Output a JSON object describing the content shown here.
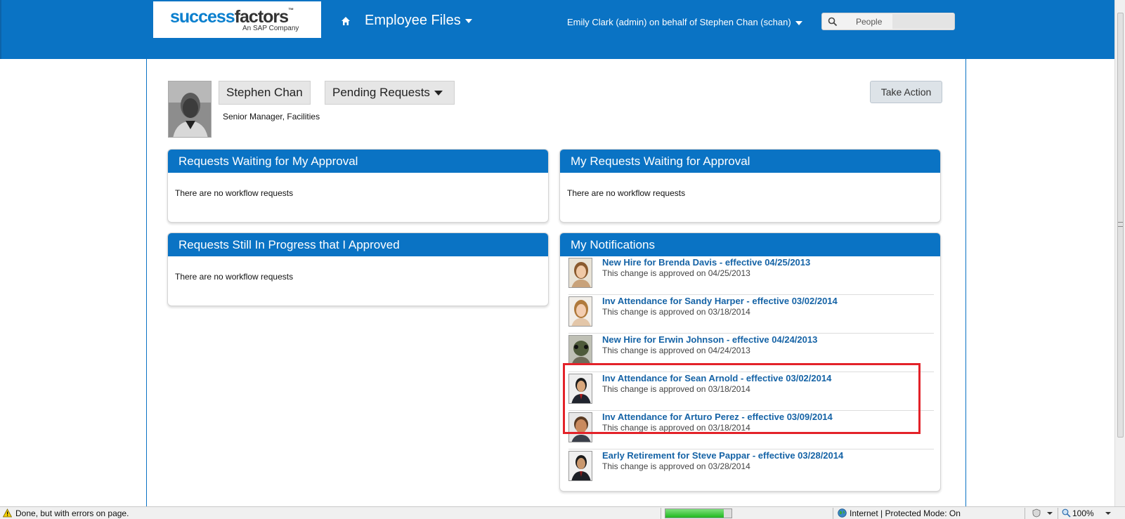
{
  "header": {
    "logo_brand_part1": "success",
    "logo_brand_part2": "factors",
    "logo_tm": "™",
    "logo_sub": "An SAP Company",
    "module_title": "Employee Files",
    "user_menu": "Emily Clark (admin) on behalf of Stephen Chan (schan)",
    "search_placeholder": "People",
    "brand_color": "#0a73c4"
  },
  "profile": {
    "name": "Stephen Chan",
    "view_selector": "Pending Requests",
    "job_title": "Senior Manager, Facilities",
    "take_action": "Take Action"
  },
  "panels": {
    "waiting_my_approval": {
      "title": "Requests Waiting for My Approval",
      "empty": "There are no workflow requests"
    },
    "my_requests_waiting": {
      "title": "My Requests Waiting for Approval",
      "empty": "There are no workflow requests"
    },
    "in_progress_approved": {
      "title": "Requests Still In Progress that I Approved",
      "empty": "There are no workflow requests"
    },
    "notifications": {
      "title": "My Notifications",
      "items": [
        {
          "title": "New Hire for Brenda Davis - effective 04/25/2013",
          "sub": "This change is approved on 04/25/2013"
        },
        {
          "title": "Inv Attendance for Sandy Harper - effective 03/02/2014",
          "sub": "This change is approved on 03/18/2014"
        },
        {
          "title": "New Hire for Erwin Johnson - effective 04/24/2013",
          "sub": "This change is approved on 04/24/2013"
        },
        {
          "title": "Inv Attendance for Sean Arnold - effective 03/02/2014",
          "sub": "This change is approved on 03/18/2014"
        },
        {
          "title": "Inv Attendance for Arturo Perez - effective 03/09/2014",
          "sub": "This change is approved on 03/18/2014"
        },
        {
          "title": "Early Retirement for Steve Pappar - effective 03/28/2014",
          "sub": "This change is approved on 03/28/2014"
        }
      ]
    }
  },
  "statusbar": {
    "status": "Done, but with errors on page.",
    "zone": "Internet | Protected Mode: On",
    "zoom": "100%",
    "progress_fraction": 0.88
  },
  "highlight_color": "#e32229"
}
